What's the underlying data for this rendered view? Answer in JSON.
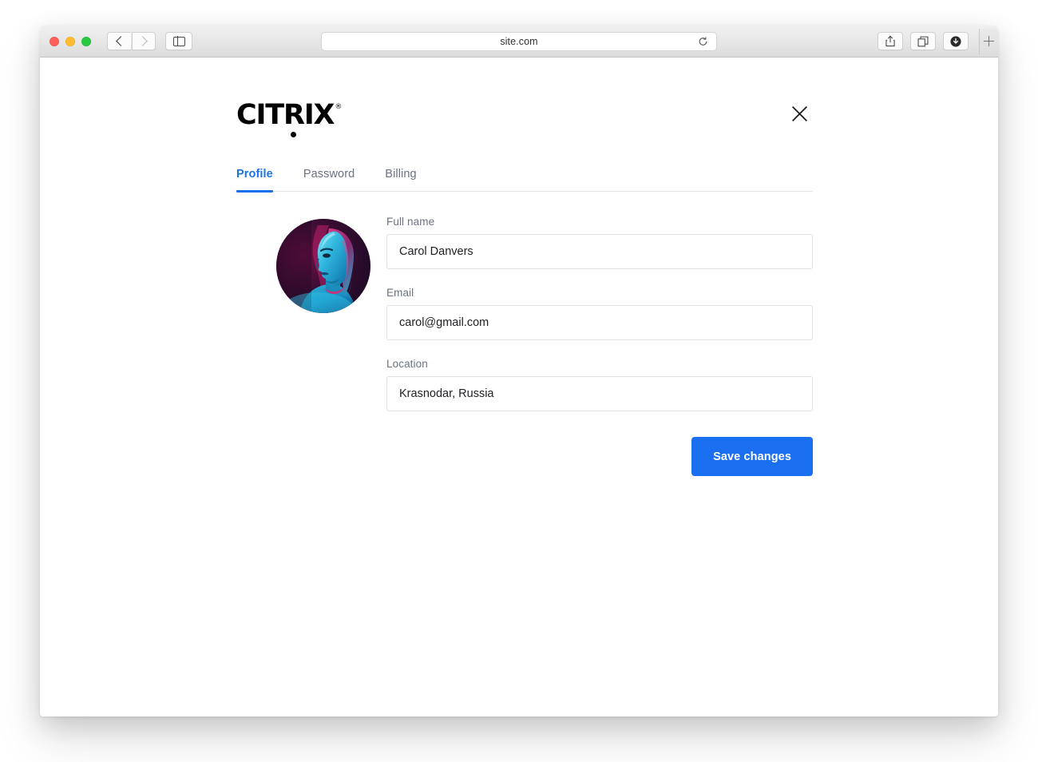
{
  "browser": {
    "url": "site.com",
    "traffic_lights": [
      {
        "name": "close",
        "color": "#ff5f57"
      },
      {
        "name": "minimize",
        "color": "#febc2e"
      },
      {
        "name": "maximize",
        "color": "#28c840"
      }
    ],
    "toolbar": {
      "back_icon": "chevron-left-icon",
      "forward_icon": "chevron-right-icon",
      "sidebar_icon": "sidebar-toggle-icon",
      "reload_icon": "reload-icon",
      "share_icon": "share-icon",
      "tabs_overview_icon": "tab-overview-icon",
      "downloads_icon": "downloads-icon",
      "new_tab_icon": "plus-icon"
    }
  },
  "modal": {
    "logo_text": "CITRIX",
    "logo_trademark": "®",
    "close_label": "×",
    "tabs": [
      {
        "label": "Profile",
        "active": true
      },
      {
        "label": "Password",
        "active": false
      },
      {
        "label": "Billing",
        "active": false
      }
    ],
    "avatar_alt": "user-avatar",
    "fields": [
      {
        "label": "Full name",
        "value": "Carol Danvers",
        "placeholder": "Full name"
      },
      {
        "label": "Email",
        "value": "carol@gmail.com",
        "placeholder": "Email"
      },
      {
        "label": "Location",
        "value": "Krasnodar, Russia",
        "placeholder": "Location"
      }
    ],
    "save_label": "Save changes"
  },
  "colors": {
    "accent": "#1a6ff0",
    "active_tab": "#1a73e8",
    "label": "#6b7280",
    "value": "#202124",
    "border": "#dfe1e5"
  }
}
